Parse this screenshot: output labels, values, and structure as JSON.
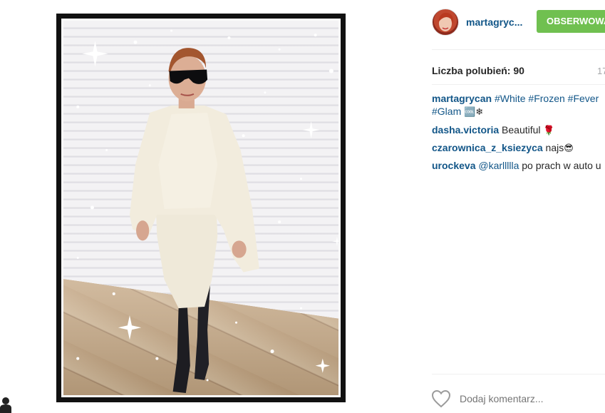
{
  "post": {
    "image_alt": "",
    "author": {
      "username": "martagryc...",
      "follow_label": "OBSERWOWA"
    },
    "likes_label": "Liczba polubień: 90",
    "timestamp": "17",
    "comments": [
      {
        "author": "martagrycan",
        "tags": [
          "#White",
          "#Frozen",
          "#Fever",
          "#Glam"
        ],
        "emoji": "🆒❄"
      },
      {
        "author": "dasha.victoria",
        "text": "Beautiful",
        "emoji": "🌹"
      },
      {
        "author": "czarownica_z_ksiezyca",
        "text": "najs",
        "emoji": "😎"
      },
      {
        "author": "urockeva",
        "mention": "@karllllla",
        "text": "po prach w auto u"
      }
    ],
    "comment_placeholder": "Dodaj komentarz..."
  },
  "colors": {
    "link_blue": "#125688",
    "follow_green": "#70c050",
    "muted_gray": "#a5a7aa"
  },
  "icons": {
    "heart": "heart-icon",
    "corner": "profile-icon"
  }
}
